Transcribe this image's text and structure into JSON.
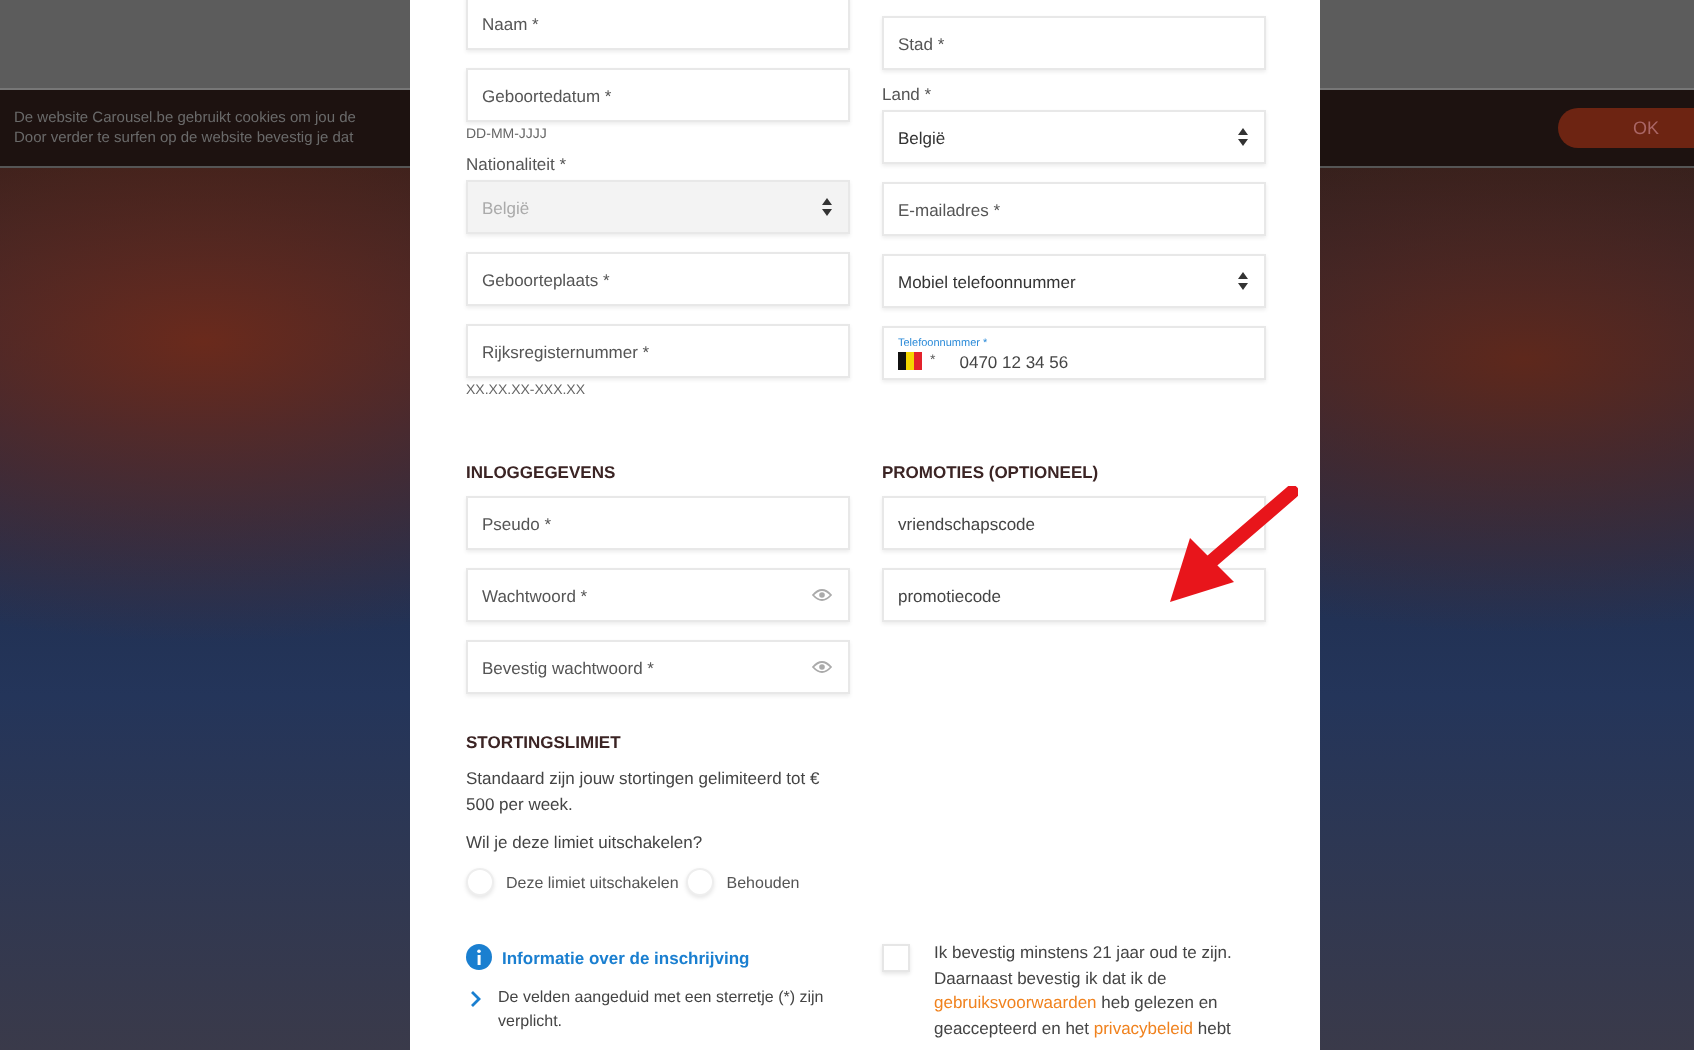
{
  "cookie_bar": {
    "lines": [
      "De website Carousel.be gebruikt cookies om jou de",
      "Door verder te surfen op de website bevestig je dat"
    ],
    "button": "OK"
  },
  "personal_left": [
    {
      "kind": "input",
      "placeholder": "Naam *"
    },
    {
      "kind": "input",
      "placeholder": "Geboortedatum *",
      "hint": "DD-MM-JJJJ"
    },
    {
      "kind": "select",
      "label": "Nationaliteit *",
      "value": "België",
      "disabled": true
    },
    {
      "kind": "input",
      "placeholder": "Geboorteplaats *"
    },
    {
      "kind": "input",
      "placeholder": "Rijksregisternummer *",
      "hint": "XX.XX.XX-XXX.XX"
    }
  ],
  "personal_right": [
    {
      "kind": "input",
      "placeholder": "Stad *"
    },
    {
      "kind": "select",
      "label": "Land *",
      "value": "België",
      "disabled": false
    },
    {
      "kind": "input",
      "placeholder": "E-mailadres *"
    },
    {
      "kind": "select",
      "value": "Mobiel telefoonnummer",
      "disabled": false
    },
    {
      "kind": "phone",
      "label": "Telefoonnummer *",
      "prefix": "*",
      "value": "0470 12 34 56"
    }
  ],
  "login": {
    "title": "INLOGGEGEVENS",
    "fields": [
      {
        "kind": "input",
        "placeholder": "Pseudo *"
      },
      {
        "kind": "password",
        "placeholder": "Wachtwoord *"
      },
      {
        "kind": "password",
        "placeholder": "Bevestig wachtwoord *"
      }
    ]
  },
  "promotions": {
    "title": "PROMOTIES (OPTIONEEL)",
    "fields": [
      {
        "placeholder": "vriendschapscode"
      },
      {
        "placeholder": "promotiecode"
      }
    ]
  },
  "deposit_limit": {
    "title": "STORTINGSLIMIET",
    "text": "Standaard zijn jouw stortingen gelimiteerd tot € 500 per week.",
    "question": "Wil je deze limiet uitschakelen?",
    "options": [
      {
        "label": "Deze limiet uitschakelen",
        "selected": false
      },
      {
        "label": "Behouden",
        "selected": false
      }
    ]
  },
  "info": {
    "title": "Informatie over de inschrijving",
    "items": [
      "De velden aangeduid met een sterretje (*) zijn verplicht."
    ]
  },
  "consent": {
    "checked": false,
    "text": "Ik bevestig minstens 21 jaar oud te zijn. Daarnaast bevestig ik dat ik de",
    "link_1": "gebruiksvoorwaarden",
    "text_2": "heb gelezen en geaccepteerd en het",
    "link_2": "privacybeleid",
    "text_3": "hebt"
  }
}
